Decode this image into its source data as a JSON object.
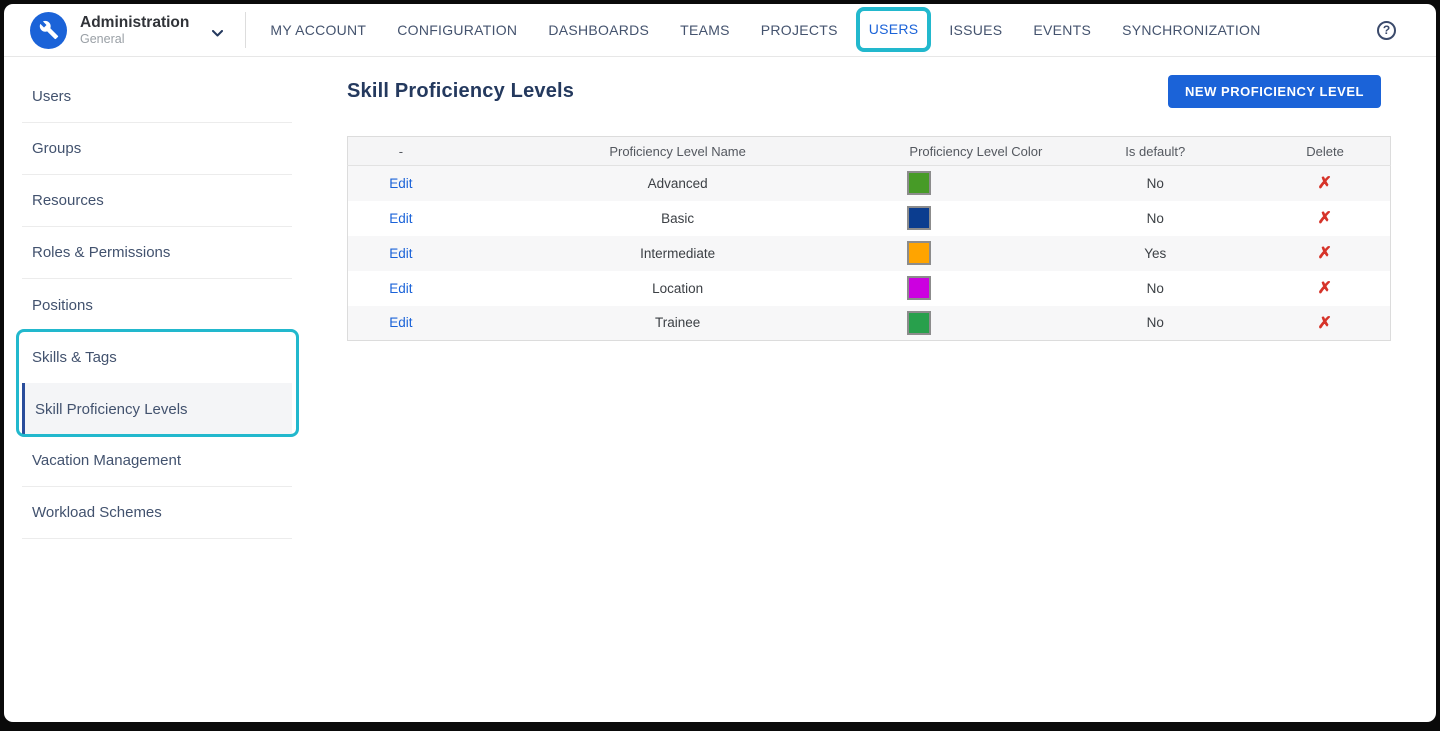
{
  "brand": {
    "title": "Administration",
    "subtitle": "General"
  },
  "nav": {
    "items": [
      {
        "label": "MY ACCOUNT"
      },
      {
        "label": "CONFIGURATION"
      },
      {
        "label": "DASHBOARDS"
      },
      {
        "label": "TEAMS"
      },
      {
        "label": "PROJECTS"
      },
      {
        "label": "USERS",
        "active": true,
        "annotated": true
      },
      {
        "label": "ISSUES"
      },
      {
        "label": "EVENTS"
      },
      {
        "label": "SYNCHRONIZATION"
      }
    ]
  },
  "icons": {
    "logo": "wrench-icon",
    "help_glyph": "?",
    "delete_glyph": "✗"
  },
  "sidebar": {
    "items": [
      {
        "label": "Users"
      },
      {
        "label": "Groups"
      },
      {
        "label": "Resources"
      },
      {
        "label": "Roles & Permissions"
      },
      {
        "label": "Positions"
      },
      {
        "label": "Skills & Tags"
      },
      {
        "label": "Skill Proficiency Levels",
        "active": true
      },
      {
        "label": "Vacation Management"
      },
      {
        "label": "Workload Schemes"
      }
    ]
  },
  "main": {
    "title": "Skill Proficiency Levels",
    "new_button_label": "NEW PROFICIENCY LEVEL",
    "table": {
      "headers": [
        "-",
        "Proficiency Level Name",
        "Proficiency Level Color",
        "Is default?",
        "Delete"
      ],
      "rows": [
        {
          "action": "Edit",
          "name": "Advanced",
          "color": "#479b27",
          "is_default": "No"
        },
        {
          "action": "Edit",
          "name": "Basic",
          "color": "#0b3d8f",
          "is_default": "No"
        },
        {
          "action": "Edit",
          "name": "Intermediate",
          "color": "#ffa400",
          "is_default": "Yes"
        },
        {
          "action": "Edit",
          "name": "Location",
          "color": "#cc00e0",
          "is_default": "No"
        },
        {
          "action": "Edit",
          "name": "Trainee",
          "color": "#28a04c",
          "is_default": "No"
        }
      ]
    }
  },
  "colors": {
    "accent_blue": "#1b63d8",
    "annotation_cyan": "#22b8cd",
    "delete_red": "#d6342a",
    "active_sidebar_bar": "#2a4d9b"
  }
}
